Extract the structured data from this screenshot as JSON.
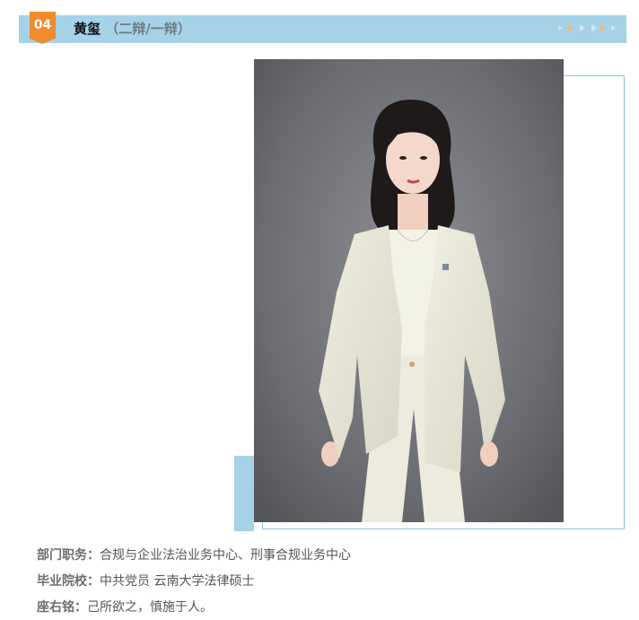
{
  "header": {
    "number": "04",
    "name": "黄玺",
    "subtitle": "（二辩/一辩）"
  },
  "colors": {
    "header_bg": "#a6d2e8",
    "badge": "#f08c2c",
    "frame": "#8cc5df"
  },
  "info": {
    "department": {
      "label": "部门职务：",
      "value": "合规与企业法治业务中心、刑事合规业务中心"
    },
    "school": {
      "label": "毕业院校：",
      "value": "中共党员 云南大学法律硕士"
    },
    "motto": {
      "label": "座右铭：",
      "value": "己所欲之，慎施于人。"
    }
  }
}
